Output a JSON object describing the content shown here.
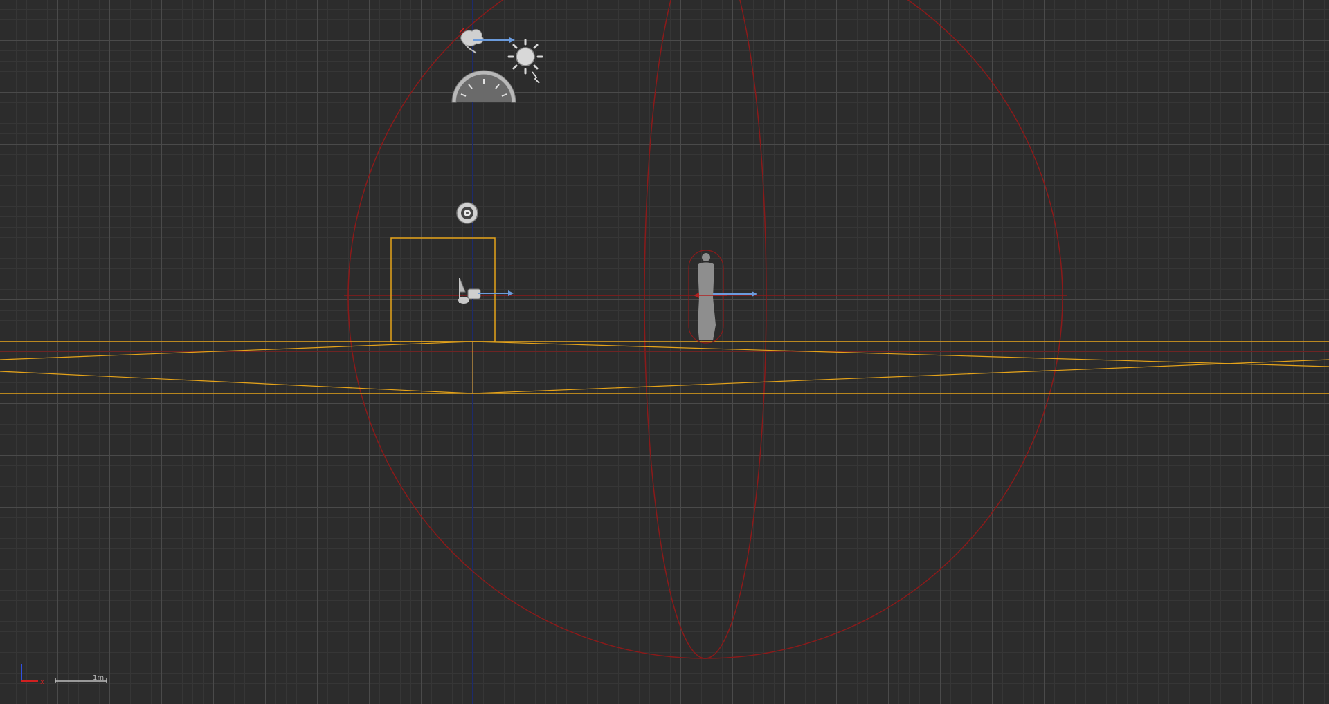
{
  "viewport": {
    "view": "top-orthographic",
    "background_color": "#2c2c2c",
    "major_grid_color": "#4a4a4a",
    "minor_grid_color": "#363636"
  },
  "scene_objects": [
    {
      "name": "wind-emitter",
      "icon": "wind-icon",
      "selected": false
    },
    {
      "name": "sun-light",
      "icon": "sun-icon",
      "selected": false
    },
    {
      "name": "sky-dome",
      "icon": "dome-icon",
      "selected": false
    },
    {
      "name": "audio-source",
      "icon": "speaker-icon",
      "selected": false
    },
    {
      "name": "player-start",
      "icon": "flag-icon",
      "selected": true
    },
    {
      "name": "character-capsule",
      "icon": "character-icon",
      "selected": false
    },
    {
      "name": "ground-plane",
      "icon": "mesh-icon",
      "selected": true
    }
  ],
  "colors": {
    "selection": "#e5a31a",
    "bounds": "#8b1a1a",
    "axis_y": "#1c2a6b",
    "arrow": "#6b9bdc"
  },
  "scale_bar": {
    "label": "1m"
  },
  "axis_gizmo": {
    "x_label": "x",
    "x_color": "#d02020",
    "y_color": "#3050e0"
  }
}
